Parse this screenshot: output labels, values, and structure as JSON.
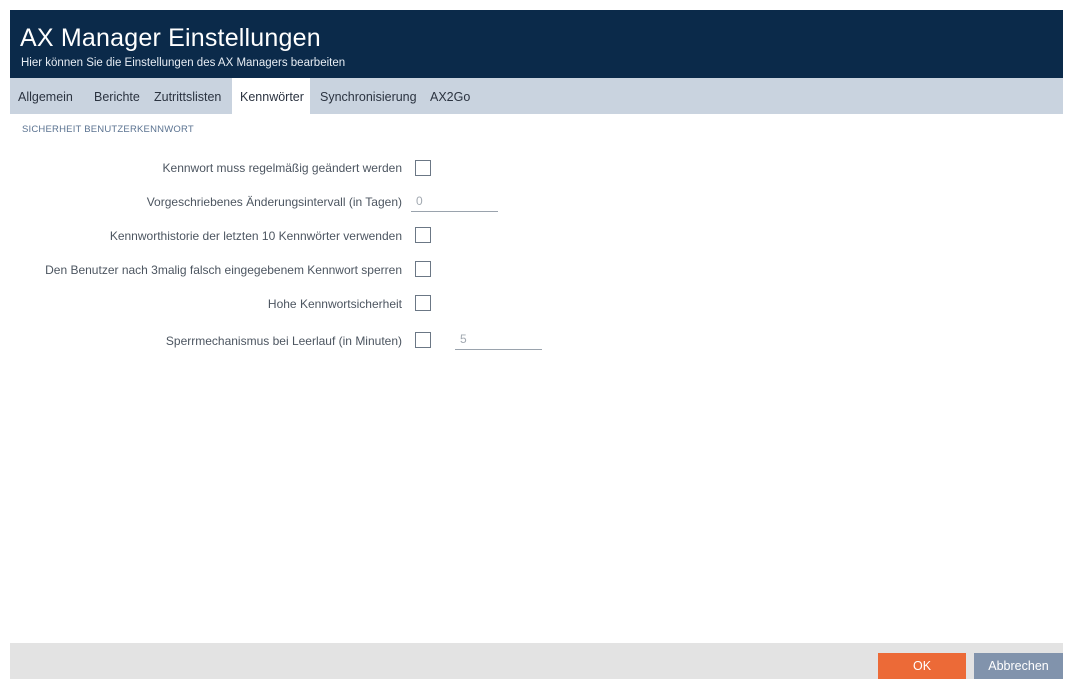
{
  "header": {
    "title": "AX Manager Einstellungen",
    "subtitle": "Hier können Sie die Einstellungen des AX Managers bearbeiten"
  },
  "tabs": [
    {
      "label": "Allgemein"
    },
    {
      "label": "Berichte"
    },
    {
      "label": "Zutrittslisten"
    },
    {
      "label": "Kennwörter",
      "active": true
    },
    {
      "label": "Synchronisierung"
    },
    {
      "label": "AX2Go"
    }
  ],
  "section": {
    "title": "SICHERHEIT BENUTZERKENNWORT",
    "rows": [
      {
        "label": "Kennwort muss regelmäßig geändert werden",
        "checked": false
      },
      {
        "label": "Vorgeschriebenes Änderungsintervall (in Tagen)",
        "value": "0"
      },
      {
        "label": "Kennworthistorie der letzten 10 Kennwörter verwenden",
        "checked": false
      },
      {
        "label": "Den Benutzer nach 3malig falsch eingegebenem Kennwort sperren",
        "checked": false
      },
      {
        "label": "Hohe Kennwortsicherheit",
        "checked": false
      },
      {
        "label": "Sperrmechanismus bei Leerlauf (in Minuten)",
        "checked": false,
        "value": "5"
      }
    ]
  },
  "footer": {
    "ok_label": "OK",
    "cancel_label": "Abbrechen"
  },
  "colors": {
    "header_bg": "#0b2a4a",
    "tabs_bg": "#c9d3df",
    "ok_button": "#ec6a37",
    "cancel_button": "#8193ac"
  }
}
